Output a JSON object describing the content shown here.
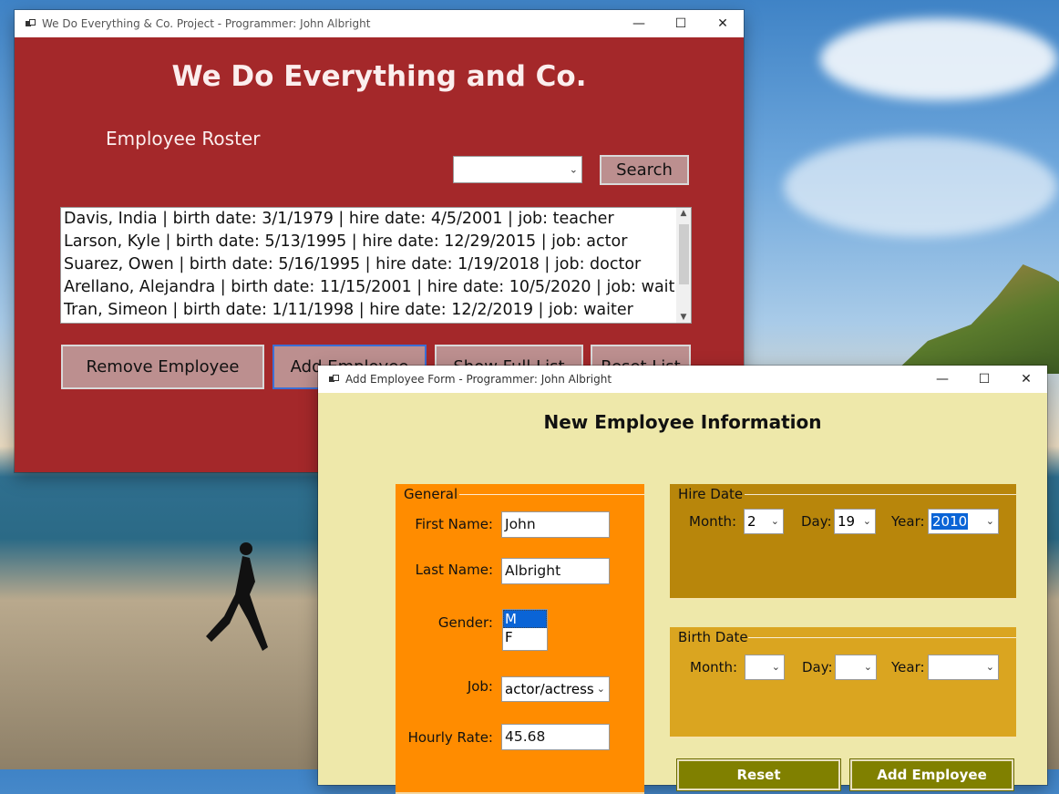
{
  "main_window": {
    "title": "We Do Everything & Co. Project - Programmer: John Albright",
    "heading": "We Do Everything and Co.",
    "roster_label": "Employee Roster",
    "search_selected": "",
    "search_button": "Search",
    "employees": [
      "Davis, India | birth date: 3/1/1979 | hire date: 4/5/2001 | job: teacher",
      "Larson, Kyle | birth date: 5/13/1995 | hire date: 12/29/2015 | job: actor",
      "Suarez, Owen | birth date: 5/16/1995 | hire date: 1/19/2018 | job: doctor",
      "Arellano, Alejandra | birth date: 11/15/2001 | hire date: 10/5/2020 | job: waitress",
      "Tran, Simeon | birth date: 1/11/1998 | hire date: 12/2/2019 | job: waiter"
    ],
    "buttons": {
      "remove": "Remove Employee",
      "add": "Add Employee",
      "full": "Show Full List",
      "reset": "Reset List"
    }
  },
  "add_window": {
    "title": "Add Employee Form - Programmer: John Albright",
    "heading": "New Employee Information",
    "general": {
      "legend": "General",
      "first_name_label": "First Name:",
      "first_name": "John",
      "last_name_label": "Last Name:",
      "last_name": "Albright",
      "gender_label": "Gender:",
      "gender_options": [
        "M",
        "F"
      ],
      "gender_selected": "M",
      "job_label": "Job:",
      "job": "actor/actress",
      "rate_label": "Hourly Rate:",
      "rate": "45.68"
    },
    "hire_date": {
      "legend": "Hire Date",
      "month_label": "Month:",
      "month": "2",
      "day_label": "Day:",
      "day": "19",
      "year_label": "Year:",
      "year": "2010"
    },
    "birth_date": {
      "legend": "Birth Date",
      "month_label": "Month:",
      "month": "",
      "day_label": "Day:",
      "day": "",
      "year_label": "Year:",
      "year": ""
    },
    "buttons": {
      "reset": "Reset",
      "add": "Add Employee"
    }
  },
  "window_controls": {
    "minimize": "—",
    "maximize": "☐",
    "close": "✕"
  },
  "colors": {
    "main_bg": "#a4282a",
    "rose_button": "#bc8f8f",
    "form_bg": "#eee8aa",
    "general_bg": "#ff8c00",
    "hire_bg": "#b8860b",
    "birth_bg": "#daa520",
    "olive_button": "#808000",
    "selection": "#0a64d6"
  }
}
